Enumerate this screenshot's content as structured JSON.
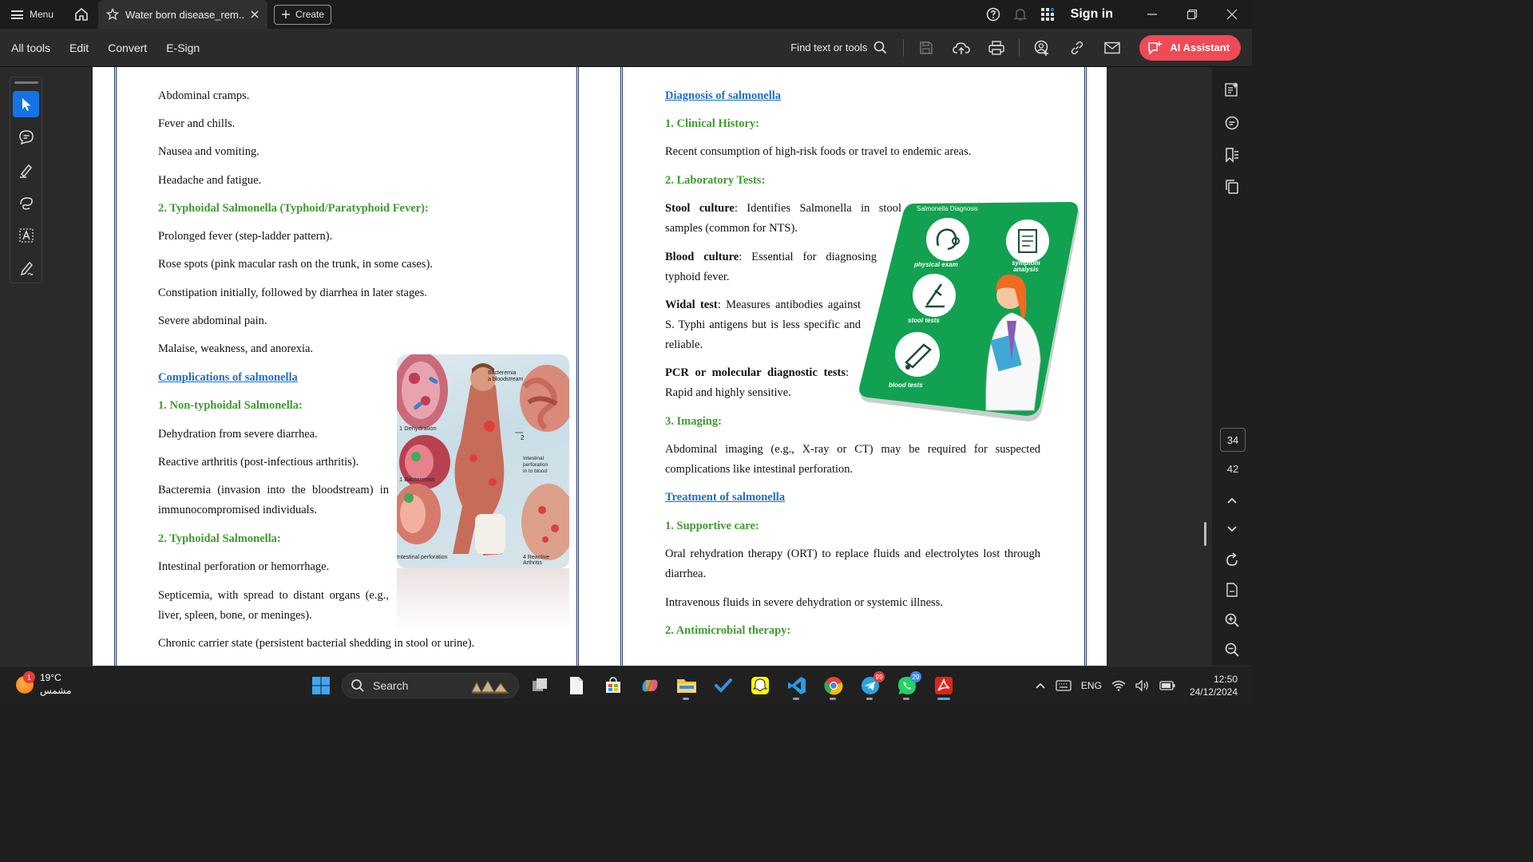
{
  "titlebar": {
    "menu_label": "Menu",
    "tab_title": "Water born disease_rem...",
    "create_label": "Create",
    "sign_in": "Sign in"
  },
  "toolbar": {
    "items": [
      "All tools",
      "Edit",
      "Convert",
      "E-Sign"
    ],
    "find_label": "Find text or tools",
    "ai_label": "AI Assistant"
  },
  "left_page": {
    "lines": [
      "Abdominal cramps.",
      "Fever and chills.",
      "Nausea and vomiting.",
      "Headache and fatigue.",
      "2. Typhoidal Salmonella (Typhoid/Paratyphoid Fever):",
      "Prolonged fever (step-ladder pattern).",
      "Rose spots (pink macular rash on the trunk, in some cases).",
      "Constipation initially, followed by diarrhea in later stages.",
      "Severe abdominal pain.",
      "Malaise, weakness, and anorexia.",
      "Complications of salmonella",
      "1. Non-typhoidal Salmonella:",
      "Dehydration from severe diarrhea.",
      "Reactive arthritis (post-infectious arthritis).",
      "Bacteremia (invasion into the bloodstream) in immunocompromised individuals.",
      "2. Typhoidal Salmonella:",
      "Intestinal perforation or hemorrhage.",
      "Septicemia, with spread to distant organs (e.g., liver, spleen, bone, or meninges).",
      "Chronic carrier state (persistent bacterial shedding in stool or urine)."
    ],
    "figure_labels": {
      "bacteremia_top": "Bacteremia",
      "bacteremia_sub": "a bloodstream",
      "dehydration": "1 Dehydration",
      "number_2": "2",
      "intestinal": "Intestinal perforation",
      "intestinal_sub": "in to blood",
      "bacteremia_left": "1 Bacteremia",
      "perforation": "Intestinal perforation",
      "reactive": "4 Reactive Arthritis"
    }
  },
  "right_page": {
    "heading_diagnosis": "Diagnosis of salmonella",
    "clinical_history": "1. Clinical History:",
    "clinical_text": "Recent consumption of high-risk foods or travel to endemic areas.",
    "lab_tests": "2. Laboratory Tests:",
    "stool_term": "Stool culture",
    "stool_text": ": Identifies Salmonella in stool samples (common for NTS).",
    "blood_term": "Blood culture",
    "blood_text": ": Essential for diagnosing typhoid fever.",
    "widal_term": "Widal test",
    "widal_text": ": Measures antibodies against S. Typhi antigens but is less specific and reliable.",
    "pcr_term": "PCR or molecular diagnostic tests",
    "pcr_text": ": Rapid and highly sensitive.",
    "imaging": "3. Imaging:",
    "imaging_text": "Abdominal imaging (e.g., X-ray or CT) may be required for suspected complications like intestinal perforation.",
    "heading_treatment": "Treatment of salmonella",
    "supportive": "1. Supportive care:",
    "ort_text": "Oral rehydration therapy (ORT) to replace fluids and electrolytes lost through diarrhea.",
    "iv_text": "Intravenous fluids in severe dehydration or systemic illness.",
    "antimicrobial": "2. Antimicrobial therapy:",
    "card": {
      "title": "Salmonella Diagnosis",
      "items": [
        "physical exam",
        "symptom analysis",
        "stool tests",
        "blood tests"
      ]
    }
  },
  "page_nav": {
    "current": "34",
    "total": "42"
  },
  "taskbar": {
    "weather_temp": "19°C",
    "weather_desc": "مشمس",
    "weather_badge": "1",
    "search_label": "Search",
    "telegram_badge": "99",
    "whatsapp_badge": "29",
    "lang": "ENG",
    "time": "12:50",
    "date": "24/12/2024"
  },
  "colors": {
    "accent_blue": "#1473e6",
    "ai_button": "#ef4b57",
    "heading_green": "#3f9b2f",
    "heading_blue": "#1f6fc7",
    "card_green": "#12a150"
  }
}
